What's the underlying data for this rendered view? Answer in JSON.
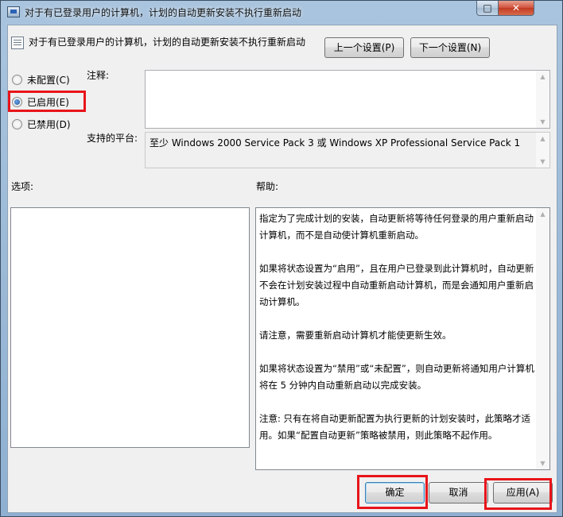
{
  "window": {
    "title": "对于有已登录用户的计算机，计划的自动更新安装不执行重新启动",
    "maximize_glyph": "□",
    "close_glyph": "✕"
  },
  "header": {
    "policy_title": "对于有已登录用户的计算机，计划的自动更新安装不执行重新启动",
    "prev_button": "上一个设置(P)",
    "next_button": "下一个设置(N)"
  },
  "state": {
    "options": [
      {
        "label": "未配置(C)",
        "checked": false
      },
      {
        "label": "已启用(E)",
        "checked": true
      },
      {
        "label": "已禁用(D)",
        "checked": false
      }
    ]
  },
  "comment": {
    "label": "注释:",
    "value": ""
  },
  "platform": {
    "label": "支持的平台:",
    "value": "至少 Windows 2000 Service Pack 3 或 Windows XP Professional Service Pack 1"
  },
  "options_section": {
    "label": "选项:"
  },
  "help_section": {
    "label": "帮助:",
    "paragraphs": [
      "指定为了完成计划的安装，自动更新将等待任何登录的用户重新启动计算机，而不是自动使计算机重新启动。",
      "如果将状态设置为“启用”，且在用户已登录到此计算机时，自动更新不会在计划安装过程中自动重新启动计算机，而是会通知用户重新启动计算机。",
      "请注意，需要重新启动计算机才能使更新生效。",
      "如果将状态设置为“禁用”或“未配置”，则自动更新将通知用户计算机将在 5 分钟内自动重新启动以完成安装。",
      "注意: 只有在将自动更新配置为执行更新的计划安装时，此策略才适用。如果“配置自动更新”策略被禁用，则此策略不起作用。"
    ]
  },
  "footer": {
    "ok": "确定",
    "cancel": "取消",
    "apply": "应用(A)"
  },
  "colors": {
    "highlight": "#e8141a",
    "title_bar": "#a9c4de",
    "client": "#f0f0f0"
  },
  "icons": {
    "app": "group-policy-icon",
    "policy": "policy-setting-icon"
  }
}
